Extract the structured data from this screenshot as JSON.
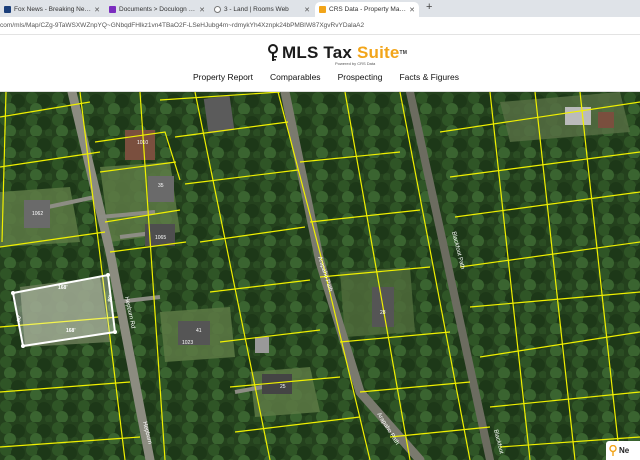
{
  "browser": {
    "tabs": [
      {
        "title": "Fox News - Breaking News Upd...",
        "favicon_color": "#1a3e7a"
      },
      {
        "title": "Documents > Doculogn Rooms",
        "favicon_color": "#7b2cbf"
      },
      {
        "title": "3 - Land | Rooms Web",
        "favicon_color": "#777777"
      },
      {
        "title": "CRS Data - Property Map for +",
        "favicon_color": "#f2a51a",
        "active": true
      }
    ],
    "new_tab_icon": "+",
    "address": "com/mls/Map/CZg-9TaWSXWZnpYQ~GNbqdFHlkz1vn4TBaO2F-LSeHJubg4m~rdmykYh4Xznpk24bPMBIW87XgvRvYDalaA2"
  },
  "app": {
    "brand_name": "MLS Tax ",
    "brand_suite": "Suite",
    "brand_tm": "TM",
    "powered_by": "Powered by CRS Data",
    "nav": [
      "Property Report",
      "Comparables",
      "Prospecting",
      "Facts & Figures"
    ]
  },
  "map": {
    "roads": [
      "Hepburn Rd",
      "Hepburn",
      "Arapaho Path",
      "Arapaho Path",
      "Blackfoot Path",
      "Blackfoot"
    ],
    "house_numbers": [
      "1010",
      "35",
      "1062",
      "1065",
      "1023",
      "41",
      "28",
      "25"
    ],
    "selected_parcel": {
      "top": "168'",
      "bottom": "168'",
      "left": "80'",
      "right": "80'"
    }
  },
  "widget": {
    "label": "Ne"
  },
  "colors": {
    "parcel_line": "#f0f000",
    "selected": "#ffffff",
    "brand_accent": "#f2a51a"
  }
}
